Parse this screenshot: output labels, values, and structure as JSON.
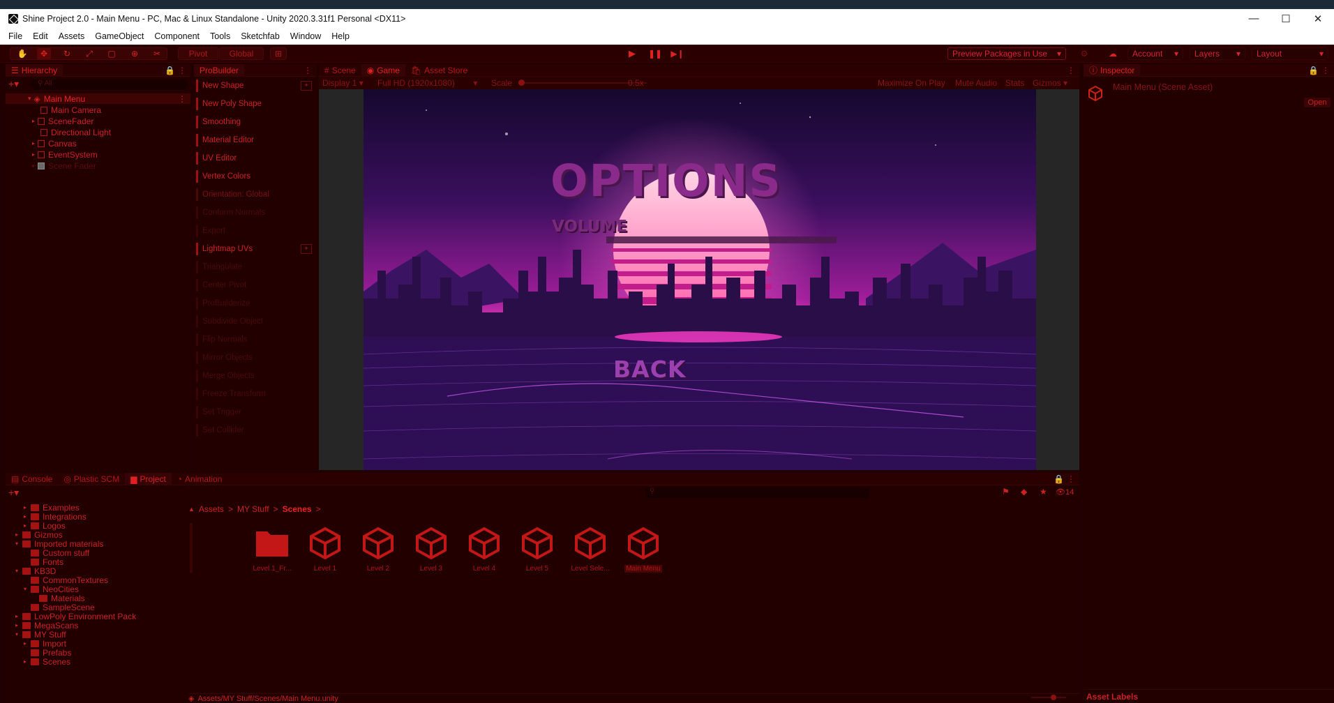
{
  "window": {
    "title": "Shine Project 2.0 - Main Menu - PC, Mac & Linux Standalone - Unity 2020.3.31f1 Personal <DX11>",
    "minimize": "—",
    "maximize": "☐",
    "close": "✕"
  },
  "menu": [
    "File",
    "Edit",
    "Assets",
    "GameObject",
    "Component",
    "Tools",
    "Sketchfab",
    "Window",
    "Help"
  ],
  "toolbar": {
    "pivot": "Pivot",
    "global": "Global",
    "preview_packages": "Preview Packages in Use",
    "account": "Account",
    "layers": "Layers",
    "layout": "Layout"
  },
  "hierarchy": {
    "tab": "Hierarchy",
    "search_placeholder": "All",
    "root": "Main Menu",
    "items": [
      "Main Camera",
      "SceneFader",
      "Directional Light",
      "Canvas",
      "EventSystem",
      "Scene Fader"
    ]
  },
  "probuilder": {
    "tab": "ProBuilder",
    "items": [
      "New Shape",
      "New Poly Shape",
      "Smoothing",
      "Material Editor",
      "UV Editor",
      "Vertex Colors",
      "Orientation: Global",
      "Conform Normals",
      "Export",
      "Lightmap UVs",
      "Triangulate",
      "Center Pivot",
      "ProBuilderize",
      "Subdivide Object",
      "Flip Normals",
      "Mirror Objects",
      "Merge Objects",
      "Freeze Transform",
      "Set Trigger",
      "Set Collider"
    ]
  },
  "game": {
    "tabs": [
      "Scene",
      "Game",
      "Asset Store"
    ],
    "display": "Display 1",
    "resolution": "Full HD (1920x1080)",
    "scale_label": "Scale",
    "scale_value": "0.5x",
    "maximize_on_play": "Maximize On Play",
    "mute_audio": "Mute Audio",
    "stats": "Stats",
    "gizmos": "Gizmos",
    "options_title": "OPTIONS",
    "volume_label": "VOLUME",
    "back_button": "BACK"
  },
  "inspector": {
    "tab": "Inspector",
    "object": "Main Menu (Scene Asset)",
    "open_button": "Open",
    "asset_labels": "Asset Labels"
  },
  "bottom": {
    "tabs": [
      "Console",
      "Plastic SCM",
      "Project",
      "Animation"
    ],
    "active_tab": "Project",
    "hidden_count": "14",
    "breadcrumb": [
      "Assets",
      "MY Stuff",
      "Scenes"
    ],
    "tree": [
      {
        "label": "Examples",
        "indent": 2,
        "type": "folder",
        "arrow": "▸"
      },
      {
        "label": "Integrations",
        "indent": 2,
        "type": "folder",
        "arrow": "▸"
      },
      {
        "label": "Logos",
        "indent": 2,
        "type": "folder",
        "arrow": "▸"
      },
      {
        "label": "Gizmos",
        "indent": 1,
        "type": "folder",
        "arrow": "▸"
      },
      {
        "label": "Imported materials",
        "indent": 1,
        "type": "folder",
        "arrow": "▾"
      },
      {
        "label": "Custom stuff",
        "indent": 2,
        "type": "folder",
        "arrow": ""
      },
      {
        "label": "Fonts",
        "indent": 2,
        "type": "folder",
        "arrow": ""
      },
      {
        "label": "KB3D",
        "indent": 1,
        "type": "folder",
        "arrow": "▾"
      },
      {
        "label": "CommonTextures",
        "indent": 2,
        "type": "folder",
        "arrow": ""
      },
      {
        "label": "NeoCities",
        "indent": 2,
        "type": "folder",
        "arrow": "▾"
      },
      {
        "label": "Materials",
        "indent": 3,
        "type": "folder",
        "arrow": ""
      },
      {
        "label": "SampleScene",
        "indent": 2,
        "type": "folder",
        "arrow": ""
      },
      {
        "label": "LowPoly Environment Pack",
        "indent": 1,
        "type": "folder",
        "arrow": "▸"
      },
      {
        "label": "MegaScans",
        "indent": 1,
        "type": "folder",
        "arrow": "▸"
      },
      {
        "label": "MY Stuff",
        "indent": 1,
        "type": "folder",
        "arrow": "▾"
      },
      {
        "label": "Import",
        "indent": 2,
        "type": "folder",
        "arrow": "▸"
      },
      {
        "label": "Prefabs",
        "indent": 2,
        "type": "folder",
        "arrow": ""
      },
      {
        "label": "Scenes",
        "indent": 2,
        "type": "folder",
        "arrow": "▸"
      }
    ],
    "assets": [
      {
        "label": "Level 1_Fr...",
        "type": "folder"
      },
      {
        "label": "Level 1",
        "type": "unity"
      },
      {
        "label": "Level 2",
        "type": "unity"
      },
      {
        "label": "Level 3",
        "type": "unity"
      },
      {
        "label": "Level 4",
        "type": "unity"
      },
      {
        "label": "Level 5",
        "type": "unity"
      },
      {
        "label": "Level Sele...",
        "type": "unity"
      },
      {
        "label": "Main Menu",
        "type": "unity"
      }
    ],
    "path": "Assets/MY Stuff/Scenes/Main Menu.unity"
  }
}
